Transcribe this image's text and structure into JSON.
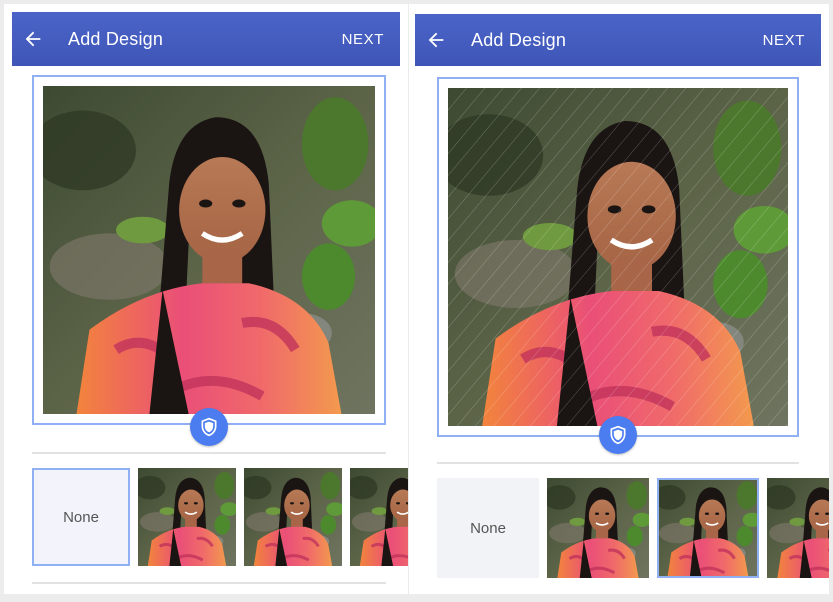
{
  "screens": [
    {
      "appbar": {
        "back_icon": "arrow-left-icon",
        "title": "Add Design",
        "next_label": "NEXT"
      },
      "preview": {
        "frame_style": "plain",
        "shield_icon": "shield-icon"
      },
      "designs": [
        {
          "label": "None",
          "selected": true
        },
        {
          "label": "",
          "selected": false
        },
        {
          "label": "",
          "selected": false
        },
        {
          "label": "",
          "selected": false
        }
      ]
    },
    {
      "appbar": {
        "back_icon": "arrow-left-icon",
        "title": "Add Design",
        "next_label": "NEXT"
      },
      "preview": {
        "frame_style": "diagonal-lines",
        "shield_icon": "shield-icon"
      },
      "designs": [
        {
          "label": "None",
          "selected": false
        },
        {
          "label": "",
          "selected": false
        },
        {
          "label": "",
          "selected": true
        },
        {
          "label": "",
          "selected": false
        }
      ]
    }
  ],
  "colors": {
    "appbar": "#4257bd",
    "accent": "#4b7df0",
    "frame_border": "#8fb0f2"
  }
}
